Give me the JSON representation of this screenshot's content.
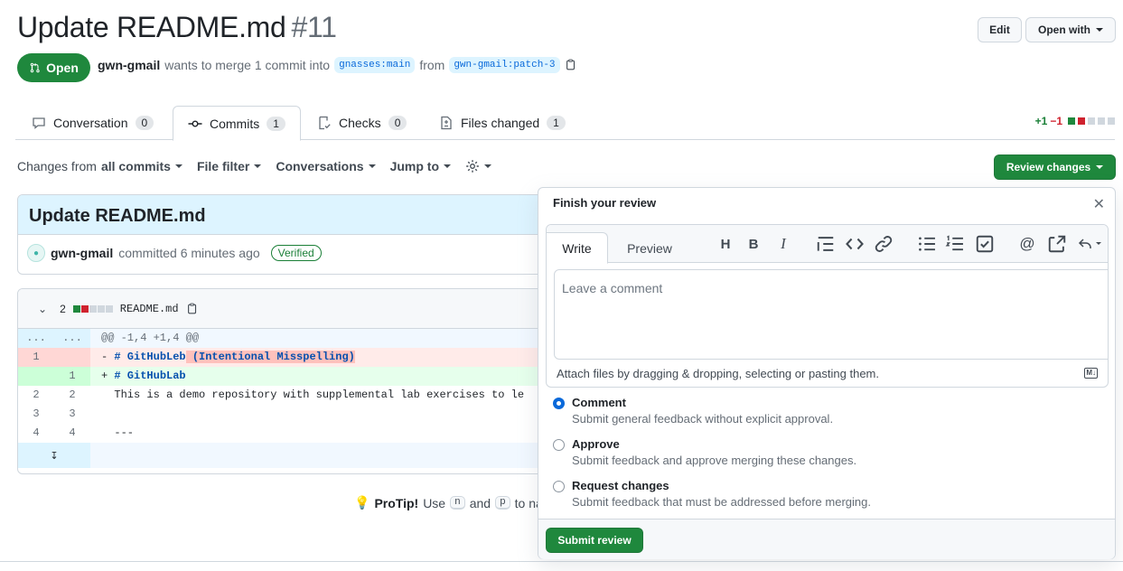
{
  "pr": {
    "title": "Update README.md",
    "number": "#11",
    "state": "Open",
    "author": "gwn-gmail",
    "merge_text": "wants to merge 1 commit into",
    "base_branch": "gnasses:main",
    "from_text": "from",
    "head_branch": "gwn-gmail:patch-3"
  },
  "header_buttons": {
    "edit": "Edit",
    "open_with": "Open with"
  },
  "tabs": [
    {
      "label": "Conversation",
      "count": "0",
      "icon": "comment-icon"
    },
    {
      "label": "Commits",
      "count": "1",
      "icon": "commit-icon"
    },
    {
      "label": "Checks",
      "count": "0",
      "icon": "checklist-icon"
    },
    {
      "label": "Files changed",
      "count": "1",
      "icon": "file-diff-icon"
    }
  ],
  "diffstat": {
    "added": "+1",
    "removed": "−1"
  },
  "toolbar": {
    "changes_from_prefix": "Changes from",
    "changes_from_value": "all commits",
    "file_filter": "File filter",
    "conversations": "Conversations",
    "jump_to": "Jump to",
    "settings_icon": "gear-icon"
  },
  "review_button": "Review changes",
  "commit": {
    "title": "Update README.md",
    "author": "gwn-gmail",
    "action": "committed 6 minutes ago",
    "verified": "Verified"
  },
  "diff": {
    "change_count": "2",
    "filename": "README.md",
    "hunk_left": "...",
    "hunk_right": "...",
    "hunk_header": "@@ -1,4 +1,4 @@",
    "lines": [
      {
        "type": "del",
        "old": "1",
        "new": "",
        "sign": "-",
        "kw": "# GitHubLeb",
        "hl": " (Intentional Misspelling)",
        "rest": ""
      },
      {
        "type": "add",
        "old": "",
        "new": "1",
        "sign": "+",
        "kw": "# GitHubLab",
        "hl": "",
        "rest": ""
      },
      {
        "type": "ctx",
        "old": "2",
        "new": "2",
        "sign": " ",
        "kw": "",
        "hl": "",
        "rest": "This is a demo repository with supplemental lab exercises to le"
      },
      {
        "type": "ctx",
        "old": "3",
        "new": "3",
        "sign": " ",
        "kw": "",
        "hl": "",
        "rest": ""
      },
      {
        "type": "ctx",
        "old": "4",
        "new": "4",
        "sign": " ",
        "kw": "",
        "hl": "",
        "rest": "---"
      }
    ]
  },
  "protip": {
    "label": "ProTip!",
    "use": "Use",
    "key1": "n",
    "and": "and",
    "key2": "p",
    "rest": "to na"
  },
  "review_popover": {
    "title": "Finish your review",
    "tab_write": "Write",
    "tab_preview": "Preview",
    "placeholder": "Leave a comment",
    "attach_text": "Attach files by dragging & dropping, selecting or pasting them.",
    "markdown_badge": "M↓",
    "options": [
      {
        "title": "Comment",
        "desc": "Submit general feedback without explicit approval.",
        "selected": true
      },
      {
        "title": "Approve",
        "desc": "Submit feedback and approve merging these changes.",
        "selected": false
      },
      {
        "title": "Request changes",
        "desc": "Submit feedback that must be addressed before merging.",
        "selected": false
      }
    ],
    "submit": "Submit review"
  },
  "colors": {
    "green": "#1f883d",
    "blue": "#0969da",
    "border": "#d0d7de"
  }
}
